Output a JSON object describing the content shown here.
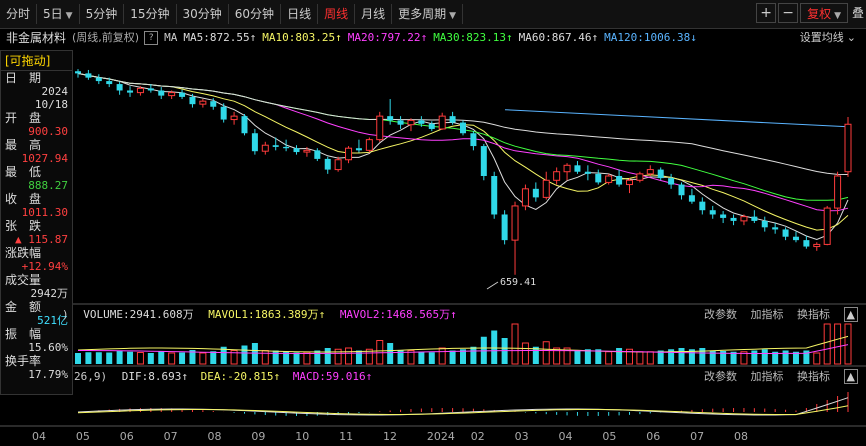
{
  "toolbar": {
    "tabs": [
      "分时",
      "5日",
      "5分钟",
      "15分钟",
      "30分钟",
      "60分钟",
      "日线",
      "周线",
      "月线",
      "更多周期"
    ],
    "active": "周线",
    "plus": "+",
    "minus": "−",
    "fuquan": "复权",
    "extra": "叠"
  },
  "header": {
    "name": "非金属材料",
    "sub": "(周线,前复权)",
    "help": "?",
    "ma_label": "MA",
    "ma": [
      {
        "label": "MA5:872.55",
        "color": "#dddddd"
      },
      {
        "label": "MA10:803.25",
        "color": "#f5f565"
      },
      {
        "label": "MA20:797.22",
        "color": "#ff40ff"
      },
      {
        "label": "MA30:823.13",
        "color": "#40ff40"
      },
      {
        "label": "MA60:867.46",
        "color": "#dddddd"
      },
      {
        "label": "MA120:1006.38",
        "color": "#5ab4ff"
      }
    ],
    "settings": "设置均线"
  },
  "infobox": {
    "title": "[可拖动]",
    "rows": [
      {
        "label": "日　期",
        "value": "2024",
        "color": "#dddddd"
      },
      {
        "label": "",
        "value": "10/18",
        "color": "#dddddd"
      },
      {
        "label": "开　盘",
        "value": "900.30",
        "color": "#ff4040"
      },
      {
        "label": "最　高",
        "value": "1027.94",
        "color": "#ff4040"
      },
      {
        "label": "最　低",
        "value": "888.27",
        "color": "#40d040"
      },
      {
        "label": "收　盘",
        "value": "1011.30",
        "color": "#ff4040"
      },
      {
        "label": "张　跌",
        "value": "▲ 115.87",
        "color": "#ff4040"
      },
      {
        "label": "涨跌幅",
        "value": "+12.94%",
        "color": "#ff4040"
      },
      {
        "label": "成交量",
        "value": "2942万",
        "color": "#dddddd"
      },
      {
        "label": "金　额",
        "value": "521亿",
        "color": "#40e0ff"
      },
      {
        "label": "振　幅",
        "value": "15.60%",
        "color": "#dddddd"
      },
      {
        "label": "换手率",
        "value": "17.79%",
        "color": "#dddddd"
      }
    ]
  },
  "volume_header": {
    "volume": "VOLUME:2941.608万",
    "mavol1": "MAVOL1:1863.389万",
    "mavol2": "MAVOL2:1468.565万",
    "btn1": "改参数",
    "btn2": "加指标",
    "btn3": "换指标"
  },
  "macd_header": {
    "params": "26,9)",
    "dif": "DIF:8.693",
    "dea": "DEA:-20.815",
    "macd": "MACD:59.016",
    "btn1": "改参数",
    "btn2": "加指标",
    "btn3": "换指标"
  },
  "chart_data": {
    "type": "candlestick",
    "x_labels": [
      "04",
      "05",
      "06",
      "07",
      "08",
      "09",
      "10",
      "11",
      "12",
      "2024",
      "02",
      "03",
      "04",
      "05",
      "06",
      "07",
      "08"
    ],
    "low_annotation": "659.41",
    "ohlc": [
      [
        1135,
        1140,
        1120,
        1130
      ],
      [
        1130,
        1138,
        1115,
        1120
      ],
      [
        1120,
        1128,
        1105,
        1112
      ],
      [
        1112,
        1120,
        1098,
        1105
      ],
      [
        1105,
        1110,
        1080,
        1090
      ],
      [
        1090,
        1100,
        1075,
        1085
      ],
      [
        1085,
        1100,
        1078,
        1095
      ],
      [
        1095,
        1105,
        1085,
        1090
      ],
      [
        1090,
        1098,
        1070,
        1078
      ],
      [
        1078,
        1090,
        1070,
        1085
      ],
      [
        1085,
        1092,
        1070,
        1075
      ],
      [
        1075,
        1082,
        1050,
        1058
      ],
      [
        1058,
        1070,
        1050,
        1065
      ],
      [
        1065,
        1072,
        1045,
        1052
      ],
      [
        1052,
        1060,
        1015,
        1022
      ],
      [
        1022,
        1040,
        1010,
        1030
      ],
      [
        1030,
        1035,
        985,
        990
      ],
      [
        990,
        1000,
        940,
        948
      ],
      [
        948,
        970,
        940,
        962
      ],
      [
        962,
        980,
        950,
        958
      ],
      [
        958,
        975,
        948,
        955
      ],
      [
        955,
        962,
        940,
        946
      ],
      [
        946,
        958,
        935,
        950
      ],
      [
        950,
        955,
        925,
        930
      ],
      [
        930,
        935,
        895,
        905
      ],
      [
        905,
        935,
        900,
        928
      ],
      [
        928,
        960,
        920,
        955
      ],
      [
        955,
        975,
        945,
        950
      ],
      [
        950,
        980,
        945,
        975
      ],
      [
        975,
        1040,
        970,
        1030
      ],
      [
        1030,
        1070,
        1010,
        1020
      ],
      [
        1020,
        1030,
        1000,
        1010
      ],
      [
        1010,
        1025,
        995,
        1020
      ],
      [
        1020,
        1030,
        1005,
        1012
      ],
      [
        1012,
        1018,
        995,
        1000
      ],
      [
        1000,
        1038,
        998,
        1030
      ],
      [
        1030,
        1040,
        1010,
        1015
      ],
      [
        1015,
        1020,
        985,
        990
      ],
      [
        990,
        995,
        950,
        960
      ],
      [
        960,
        965,
        880,
        890
      ],
      [
        890,
        900,
        790,
        800
      ],
      [
        800,
        810,
        730,
        740
      ],
      [
        740,
        830,
        659,
        820
      ],
      [
        820,
        870,
        810,
        860
      ],
      [
        860,
        875,
        830,
        840
      ],
      [
        840,
        900,
        835,
        880
      ],
      [
        880,
        910,
        870,
        900
      ],
      [
        900,
        920,
        880,
        915
      ],
      [
        915,
        925,
        895,
        900
      ],
      [
        900,
        915,
        880,
        895
      ],
      [
        895,
        905,
        870,
        875
      ],
      [
        875,
        895,
        870,
        890
      ],
      [
        890,
        905,
        865,
        870
      ],
      [
        870,
        885,
        850,
        880
      ],
      [
        880,
        900,
        875,
        895
      ],
      [
        895,
        915,
        890,
        905
      ],
      [
        905,
        910,
        880,
        885
      ],
      [
        885,
        895,
        860,
        870
      ],
      [
        870,
        875,
        835,
        845
      ],
      [
        845,
        860,
        825,
        830
      ],
      [
        830,
        840,
        800,
        810
      ],
      [
        810,
        820,
        790,
        800
      ],
      [
        800,
        808,
        780,
        792
      ],
      [
        792,
        800,
        775,
        785
      ],
      [
        785,
        800,
        775,
        795
      ],
      [
        795,
        810,
        780,
        785
      ],
      [
        785,
        795,
        760,
        770
      ],
      [
        770,
        780,
        755,
        765
      ],
      [
        765,
        770,
        740,
        748
      ],
      [
        748,
        760,
        735,
        740
      ],
      [
        740,
        750,
        720,
        725
      ],
      [
        725,
        735,
        715,
        730
      ],
      [
        730,
        820,
        728,
        815
      ],
      [
        815,
        900,
        800,
        890
      ],
      [
        900,
        1028,
        888,
        1011
      ]
    ],
    "ma": {
      "MA5": 872.55,
      "MA10": 803.25,
      "MA20": 797.22,
      "MA30": 823.13,
      "MA60": 867.46,
      "MA120": 1006.38
    },
    "volume": {
      "VOLUME": 2941.608,
      "MAVOL1": 1863.389,
      "MAVOL2": 1468.565,
      "unit": "万"
    },
    "macd": {
      "DIF": 8.693,
      "DEA": -20.815,
      "MACD": 59.016
    }
  }
}
